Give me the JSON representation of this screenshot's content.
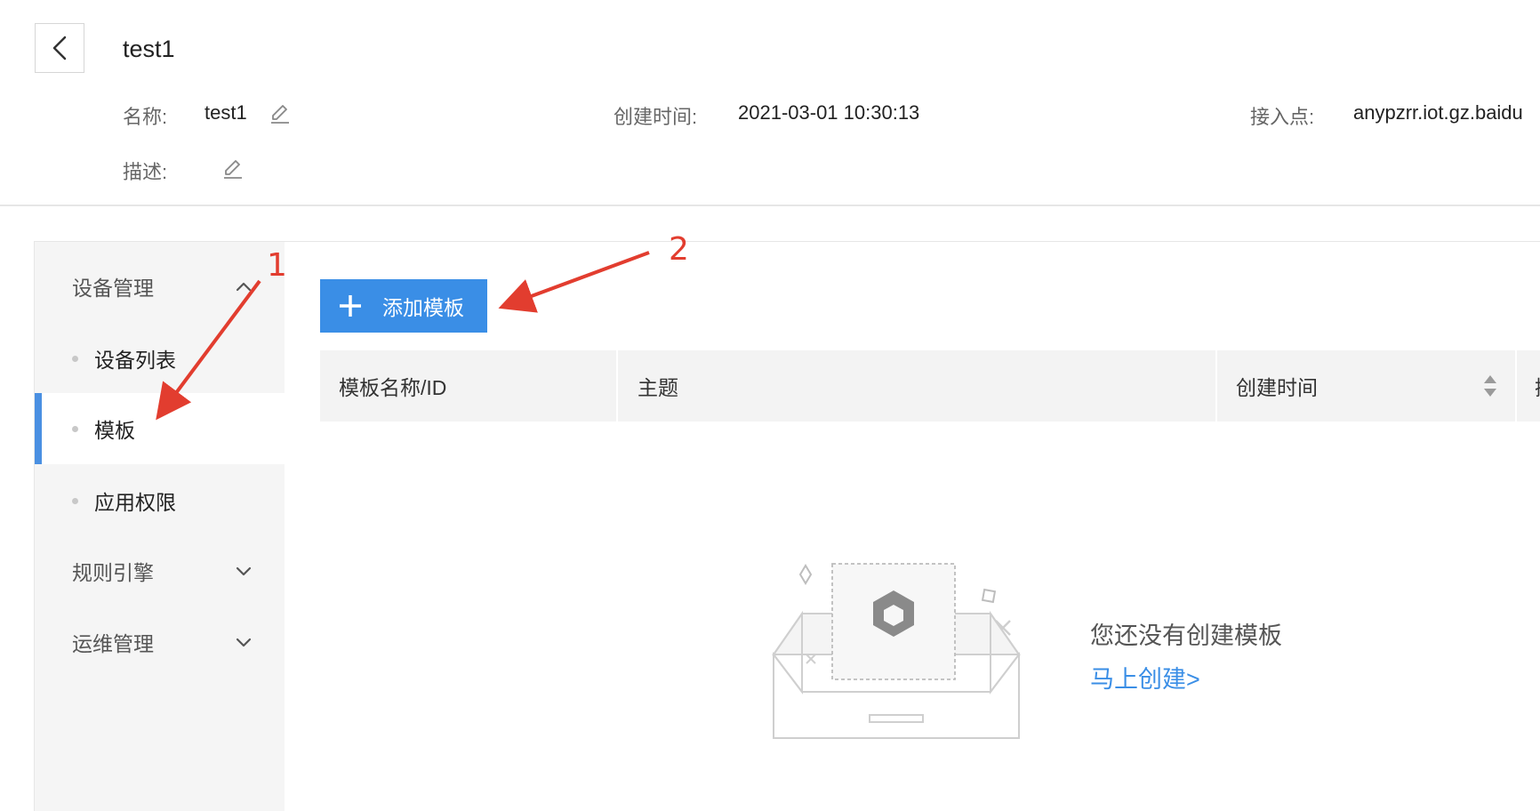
{
  "header": {
    "title": "test1",
    "back_icon": "chevron-left-icon",
    "meta": {
      "name_label": "名称:",
      "name_value": "test1",
      "created_label": "创建时间:",
      "created_value": "2021-03-01 10:30:13",
      "endpoint_label": "接入点:",
      "endpoint_value": "anypzrr.iot.gz.baidu",
      "desc_label": "描述:",
      "desc_value": ""
    }
  },
  "sidebar": {
    "groups": [
      {
        "label": "设备管理",
        "expanded": true,
        "items": [
          {
            "label": "设备列表",
            "active": false
          },
          {
            "label": "模板",
            "active": true
          },
          {
            "label": "应用权限",
            "active": false
          }
        ]
      },
      {
        "label": "规则引擎",
        "expanded": false
      },
      {
        "label": "运维管理",
        "expanded": false
      }
    ]
  },
  "toolbar": {
    "add_button_label": "添加模板",
    "add_icon": "plus-icon"
  },
  "table": {
    "columns": [
      "模板名称/ID",
      "主题",
      "创建时间",
      "操"
    ]
  },
  "empty_state": {
    "message": "您还没有创建模板",
    "link_label": "马上创建>"
  },
  "annotations": {
    "labels": [
      "1",
      "2"
    ],
    "color": "#e23d2f"
  },
  "colors": {
    "primary": "#3a8ee6",
    "active_indicator": "#4a90e2",
    "sidebar_bg": "#f5f5f5",
    "table_header_bg": "#f3f3f3"
  }
}
